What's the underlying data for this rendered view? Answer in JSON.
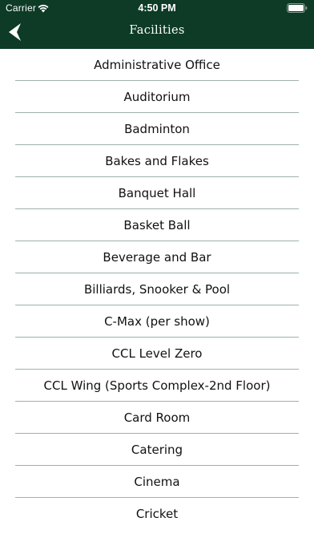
{
  "status_bar": {
    "carrier": "Carrier",
    "time": "4:50 PM"
  },
  "navbar": {
    "title": "Facilities",
    "back_icon": "back-arrow-icon"
  },
  "colors": {
    "header_bg": "#0d3b26",
    "separator": "#9fb1a8"
  },
  "facilities": [
    {
      "label": "Administrative Office"
    },
    {
      "label": "Auditorium"
    },
    {
      "label": "Badminton"
    },
    {
      "label": "Bakes and Flakes"
    },
    {
      "label": "Banquet Hall"
    },
    {
      "label": "Basket Ball"
    },
    {
      "label": "Beverage and Bar"
    },
    {
      "label": "Billiards, Snooker & Pool"
    },
    {
      "label": "C-Max (per show)"
    },
    {
      "label": "CCL Level Zero"
    },
    {
      "label": "CCL Wing (Sports Complex-2nd Floor)"
    },
    {
      "label": "Card Room"
    },
    {
      "label": "Catering"
    },
    {
      "label": "Cinema"
    },
    {
      "label": "Cricket"
    }
  ]
}
